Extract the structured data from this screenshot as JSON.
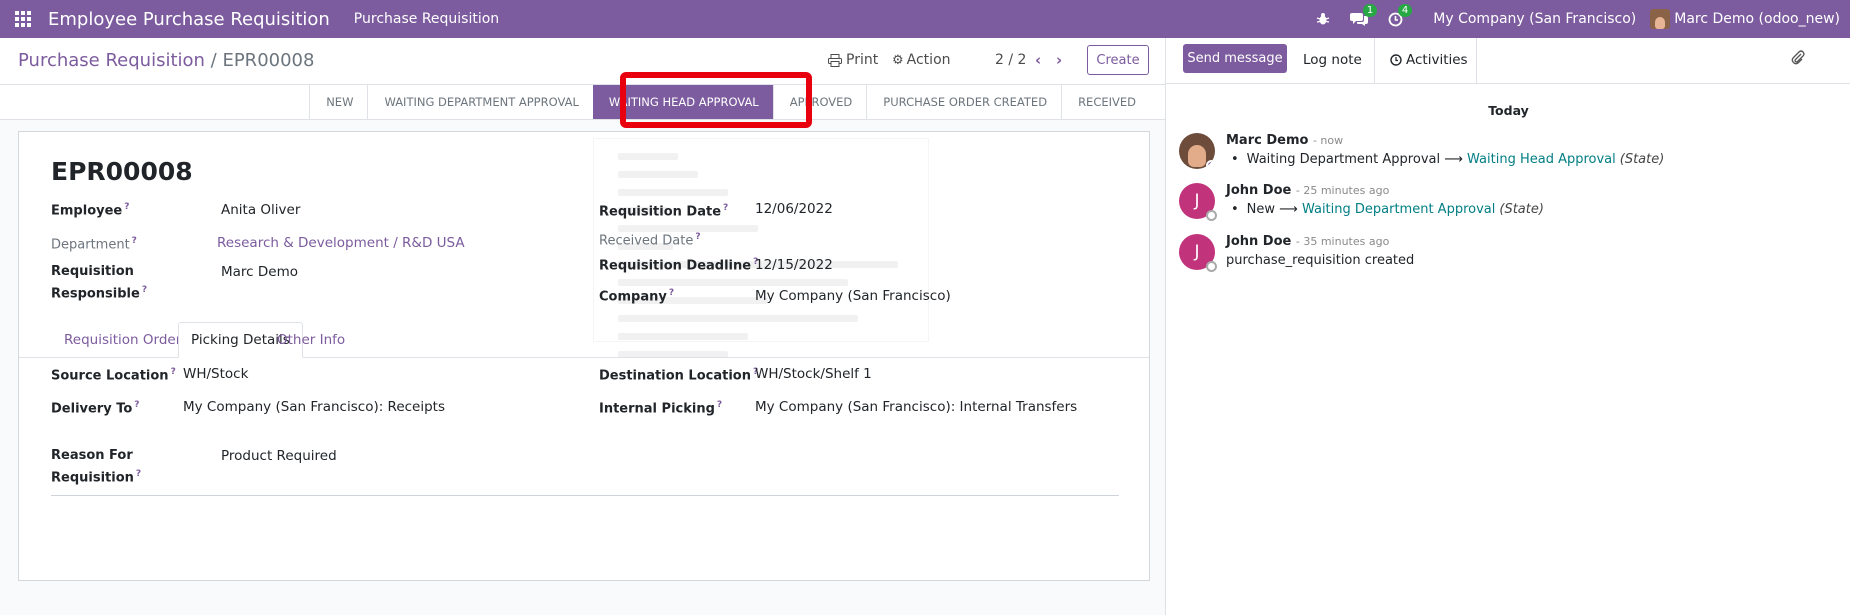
{
  "navbar": {
    "app_title": "Employee Purchase Requisition",
    "menu_item": "Purchase Requisition",
    "messages_badge": "1",
    "activities_badge": "4",
    "company": "My Company (San Francisco)",
    "user": "Marc Demo (odoo_new)"
  },
  "control_panel": {
    "breadcrumb_parent": "Purchase Requisition",
    "breadcrumb_separator": " / ",
    "breadcrumb_current": "EPR00008",
    "print_label": "Print",
    "action_label": "Action",
    "pager": "2 / 2",
    "create_label": "Create"
  },
  "statusbar": {
    "steps": [
      "New",
      "Waiting Department Approval",
      "Waiting Head Approval",
      "Approved",
      "Purchase Order Created",
      "Received"
    ],
    "active_index": 2
  },
  "form": {
    "name": "EPR00008",
    "employee_label": "Employee",
    "employee": "Anita Oliver",
    "department_label": "Department",
    "department": "Research & Development / R&D USA",
    "responsible_label_1": "Requisition",
    "responsible_label_2": "Responsible",
    "responsible": "Marc Demo",
    "req_date_label": "Requisition Date",
    "req_date": "12/06/2022",
    "received_date_label": "Received Date",
    "received_date": "",
    "deadline_label": "Requisition Deadline",
    "deadline": "12/15/2022",
    "company_label": "Company",
    "company": "My Company (San Francisco)",
    "help_mark": "?"
  },
  "tabs": [
    "Requisition Orders",
    "Picking Details",
    "Other Info"
  ],
  "active_tab": 1,
  "picking": {
    "source_label": "Source Location",
    "source": "WH/Stock",
    "dest_label": "Destination Location",
    "dest": "WH/Stock/Shelf 1",
    "delivery_label": "Delivery To",
    "delivery": "My Company (San Francisco): Receipts",
    "internal_label": "Internal Picking",
    "internal": "My Company (San Francisco): Internal Transfers",
    "reason_label_1": "Reason For",
    "reason_label_2": "Requisition",
    "reason": "Product Required"
  },
  "chatter": {
    "send_message": "Send message",
    "log_note": "Log note",
    "activities": "Activities",
    "today": "Today",
    "messages": [
      {
        "author": "Marc Demo",
        "when": "- now",
        "old": "Waiting Department Approval",
        "new": "Waiting Head Approval",
        "field": "(State)"
      },
      {
        "author": "John Doe",
        "when": "- 25 minutes ago",
        "old": "New",
        "new": "Waiting Department Approval",
        "field": "(State)"
      },
      {
        "author": "John Doe",
        "when": "- 35 minutes ago",
        "body": "purchase_requisition created"
      }
    ],
    "avatar_initial": "J",
    "arrow": "⟶"
  },
  "colors": {
    "brand": "#7c5b9e",
    "highlight": "#e8000f",
    "badge": "#28a745",
    "tracking_new": "#017e84"
  }
}
